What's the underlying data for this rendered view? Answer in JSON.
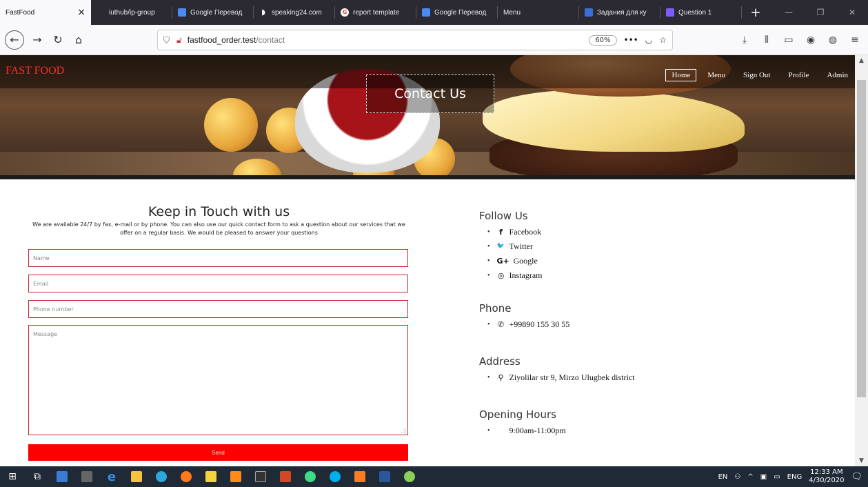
{
  "browser": {
    "tabs": [
      {
        "label": "FastFood",
        "favicon": "none",
        "active": true
      },
      {
        "label": "iuthub/ip-group",
        "favicon": "github"
      },
      {
        "label": "Google Перевод",
        "favicon": "translate"
      },
      {
        "label": "speaking24.com",
        "favicon": "speaking"
      },
      {
        "label": "report template",
        "favicon": "google"
      },
      {
        "label": "Google Перевод",
        "favicon": "translate"
      },
      {
        "label": "Menu",
        "favicon": "none"
      },
      {
        "label": "Задания для ку",
        "favicon": "task"
      },
      {
        "label": "Question 1",
        "favicon": "question"
      }
    ],
    "url_host": "fastfood_order.test",
    "url_path": "/contact",
    "zoom": "60%"
  },
  "site": {
    "brand": "FAST FOOD",
    "nav": [
      {
        "label": "Home",
        "active": true
      },
      {
        "label": "Menu"
      },
      {
        "label": "Sign Out"
      },
      {
        "label": "Profile"
      },
      {
        "label": "Admin"
      }
    ],
    "hero_title": "Contact Us"
  },
  "contact_form": {
    "title": "Keep in Touch with us",
    "description": "We are available 24/7 by fax, e-mail or by phone. You can also use our quick contact form to ask a question about our services that we offer on a regular basis. We would be pleased to answer your questions",
    "name_placeholder": "Name",
    "email_placeholder": "Email",
    "phone_placeholder": "Phone number",
    "message_placeholder": "Message",
    "send_label": "Send"
  },
  "info": {
    "follow_title": "Follow Us",
    "social": [
      {
        "icon": "facebook-icon",
        "glyph": "f",
        "label": "Facebook"
      },
      {
        "icon": "twitter-icon",
        "glyph": "🐦",
        "label": "Twitter"
      },
      {
        "icon": "google-plus-icon",
        "glyph": "G+",
        "label": "Google"
      },
      {
        "icon": "instagram-icon",
        "glyph": "◎",
        "label": "Instagram"
      }
    ],
    "phone_title": "Phone",
    "phone": "+99890 155 30 55",
    "address_title": "Address",
    "address": "Ziyolilar str 9, Mirzo Ulugbek district",
    "hours_title": "Opening Hours",
    "hours": "9:00am-11:00pm"
  },
  "taskbar": {
    "lang1": "EN",
    "lang2": "ENG",
    "time": "12:33 AM",
    "date": "4/30/2020"
  },
  "colors": {
    "accent_red": "#ff0000",
    "brand_red": "#ff2a2a",
    "field_border": "#c9262c"
  }
}
